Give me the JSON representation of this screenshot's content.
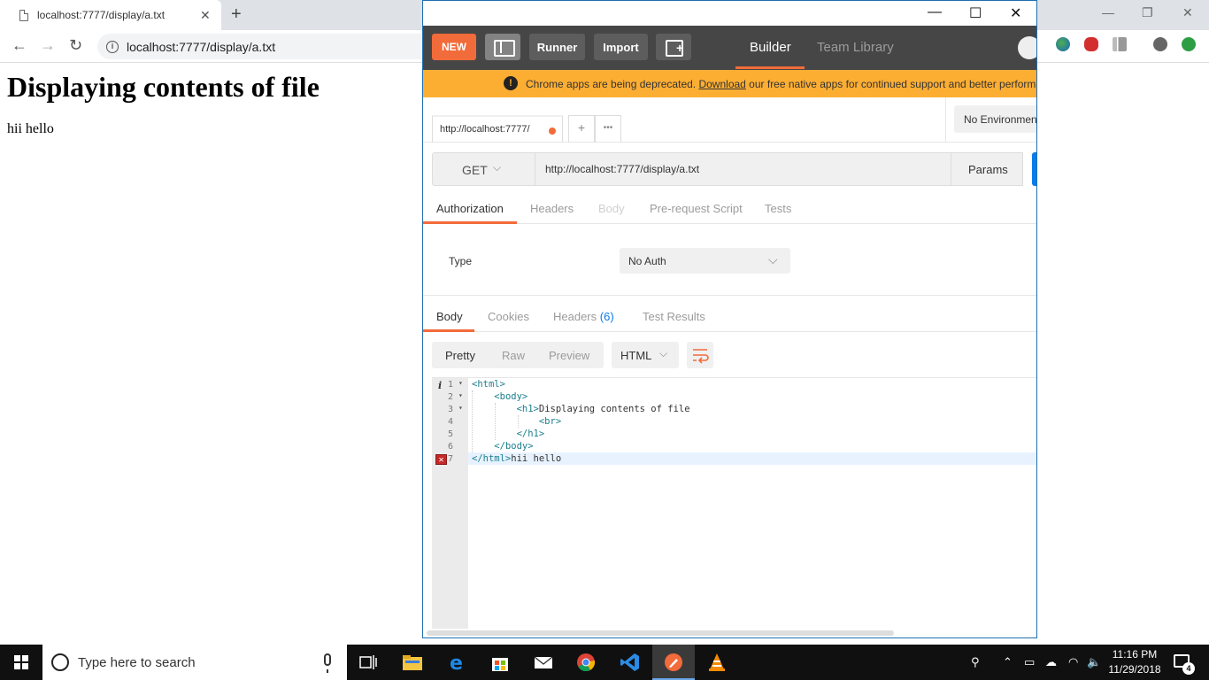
{
  "browser": {
    "tab_title": "localhost:7777/display/a.txt",
    "tab_close": "✕",
    "new_tab": "+",
    "win_min": "—",
    "win_restore": "❐",
    "win_close": "✕",
    "back": "←",
    "forward": "→",
    "reload": "↻",
    "url": "localhost:7777/display/a.txt",
    "info": "i"
  },
  "page": {
    "heading": "Displaying contents of file",
    "text": "hii hello"
  },
  "postman": {
    "window": {
      "min": "—",
      "max": "☐",
      "close": "✕"
    },
    "header": {
      "new_label": "NEW",
      "runner_label": "Runner",
      "import_label": "Import",
      "newwin_plus": "+",
      "builder_tab": "Builder",
      "team_library_tab": "Team Library"
    },
    "banner": {
      "icon": "!",
      "text_before": "Chrome apps are being deprecated. ",
      "link": "Download",
      "text_after": " our free native apps for continued support and better perform"
    },
    "request_tab": {
      "label": "http://localhost:7777/",
      "add": "+",
      "more": "•••"
    },
    "environment": "No Environmen",
    "request": {
      "method": "GET",
      "method_chev": "⌵",
      "url": "http://localhost:7777/display/a.txt",
      "params_label": "Params"
    },
    "request_tabs": [
      "Authorization",
      "Headers",
      "Body",
      "Pre-request Script",
      "Tests"
    ],
    "auth": {
      "type_label": "Type",
      "type_value": "No Auth",
      "chev": "⌵"
    },
    "response_tabs": {
      "body": "Body",
      "cookies": "Cookies",
      "headers": "Headers",
      "headers_count": "(6)",
      "test_results": "Test Results"
    },
    "response_view": {
      "pretty": "Pretty",
      "raw": "Raw",
      "preview": "Preview",
      "format": "HTML",
      "format_chev": "⌵"
    },
    "code": {
      "info_marker": "i",
      "error_marker": "✕",
      "fold_marker": "▾",
      "lines": [
        {
          "num": "1",
          "text": "<html>"
        },
        {
          "num": "2",
          "text": "    <body>"
        },
        {
          "num": "3",
          "text": "        <h1>Displaying contents of file"
        },
        {
          "num": "4",
          "text": "            <br>"
        },
        {
          "num": "5",
          "text": "        </h1>"
        },
        {
          "num": "6",
          "text": "    </body>"
        },
        {
          "num": "7",
          "text": "</html>hii hello"
        }
      ]
    }
  },
  "taskbar": {
    "search_placeholder": "Type here to search",
    "time": "11:16 PM",
    "date": "11/29/2018",
    "notifications_count": "4",
    "tray_icons": [
      "people-icon",
      "chevron-up-icon",
      "battery-icon",
      "cloud-icon",
      "wifi-icon",
      "volume-icon"
    ],
    "apps": [
      "task-view",
      "file-explorer",
      "edge",
      "store",
      "mail",
      "chrome",
      "vscode",
      "postman",
      "vlc"
    ]
  },
  "colors": {
    "postman_orange": "#f26b3a",
    "postman_header": "#464646",
    "banner": "#fcae33",
    "link_blue": "#097bed",
    "taskbar": "#101010"
  }
}
